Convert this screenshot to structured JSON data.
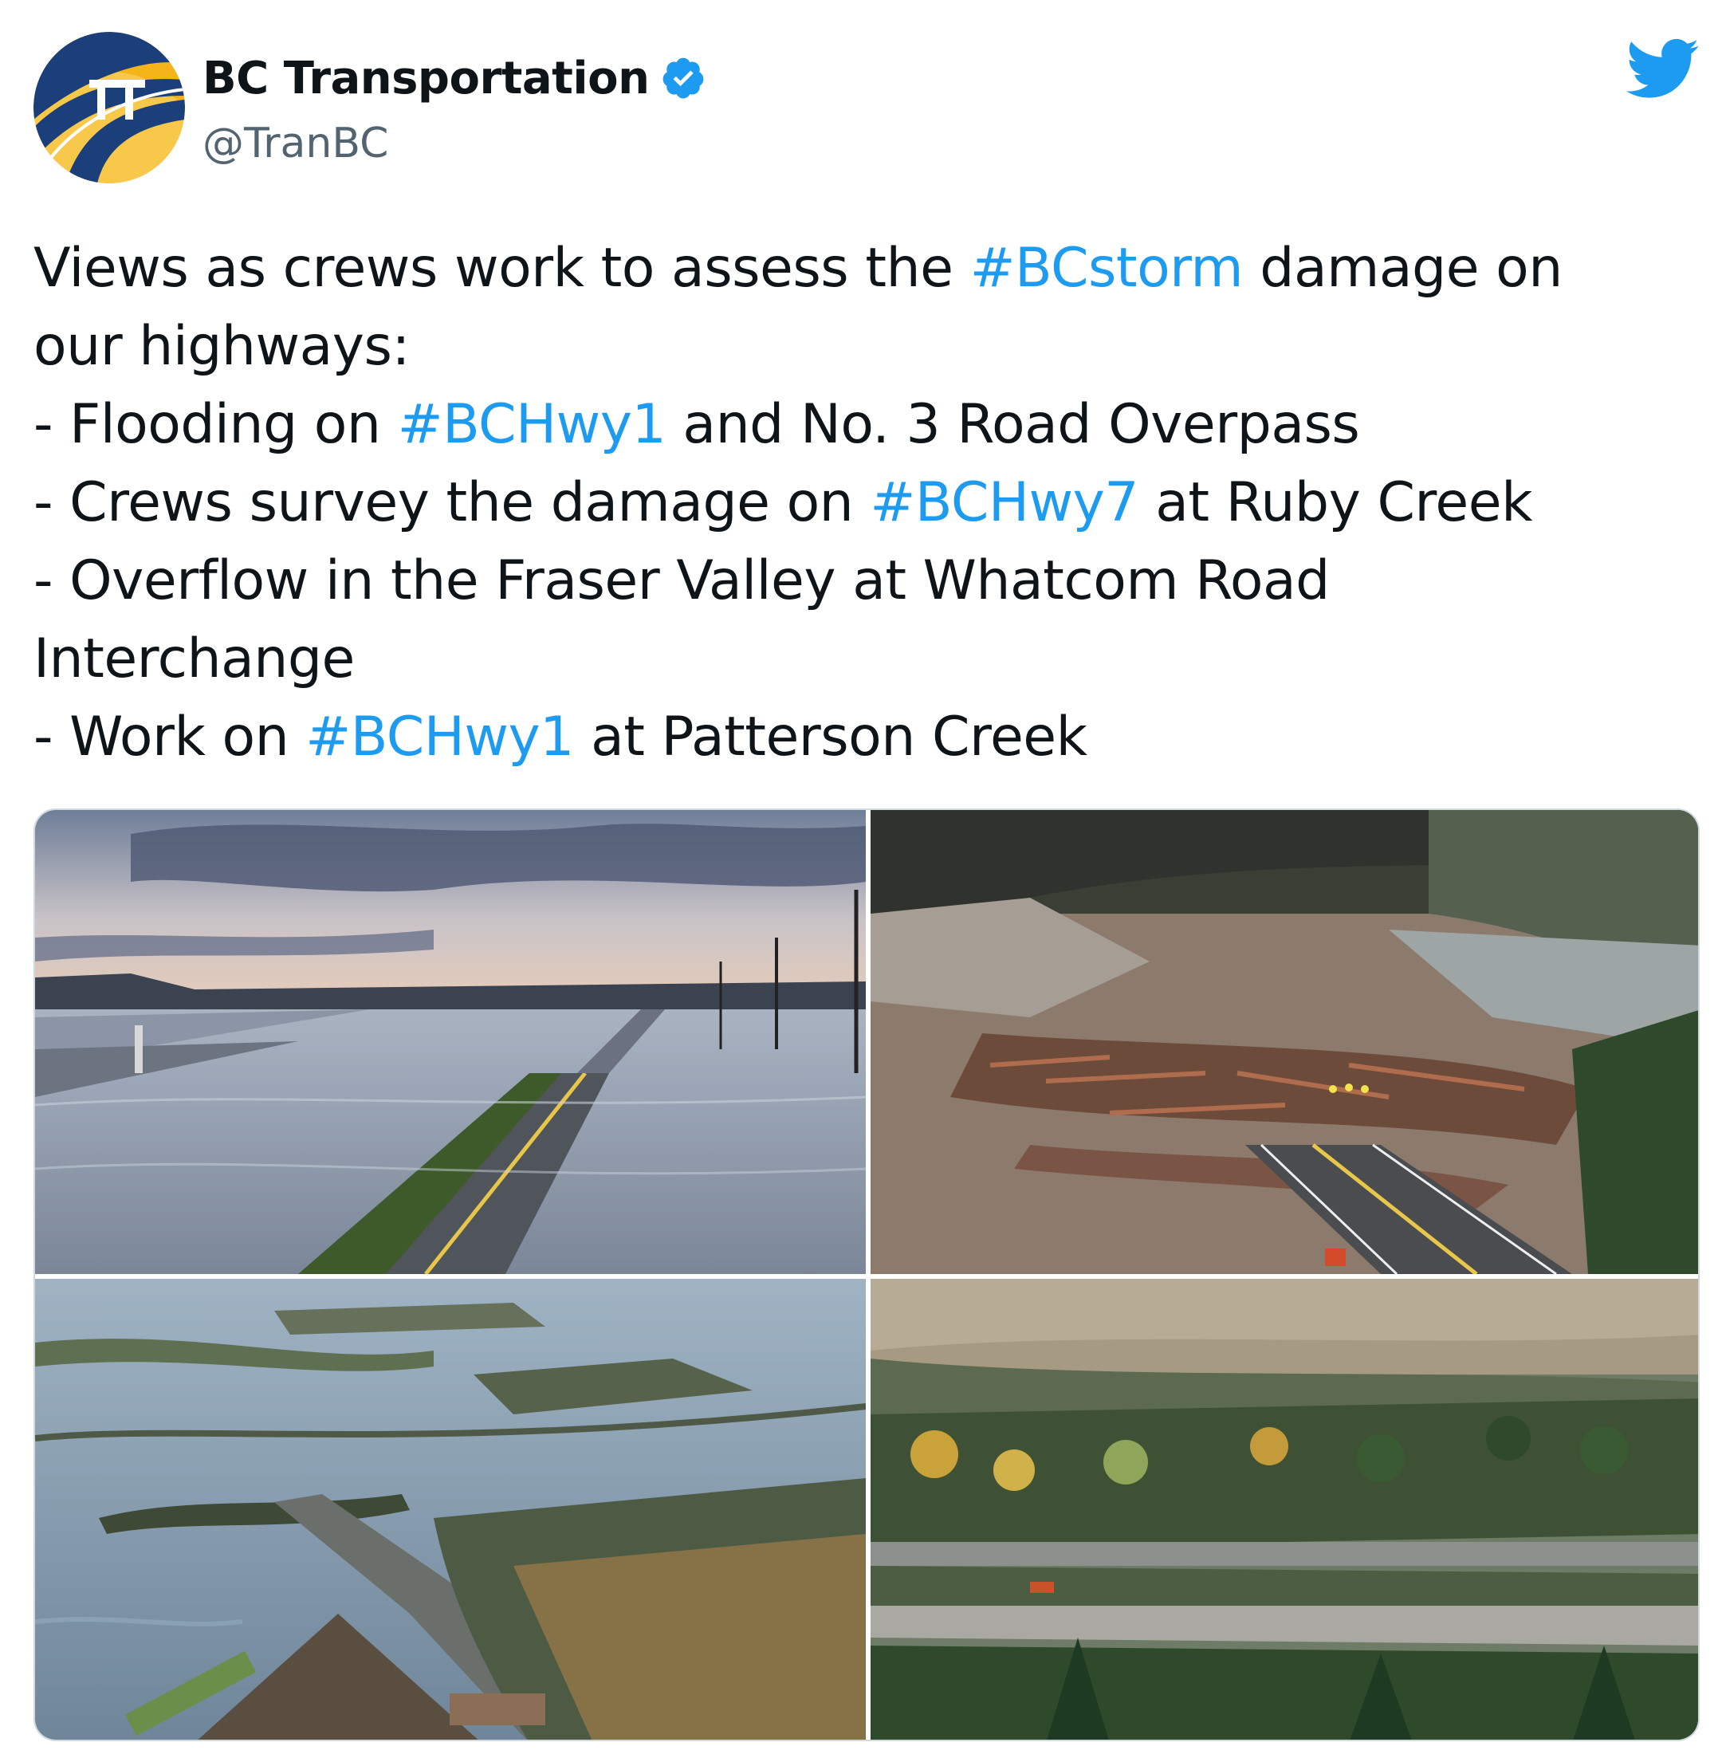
{
  "account": {
    "display_name": "BC Transportation",
    "handle": "@TranBC",
    "verified": true,
    "avatar_icon": "bc-highway-logo-icon",
    "brand_colors": {
      "avatar_blue": "#1b3f7a",
      "avatar_gold": "#f4b41a"
    }
  },
  "header": {
    "logo_icon": "twitter-bird-icon",
    "logo_color": "#1d9bf0"
  },
  "tweet": {
    "lines": [
      [
        {
          "text": "Views as crews work to assess the ",
          "hashtag": false
        },
        {
          "text": "#BCstorm",
          "hashtag": true
        },
        {
          "text": " damage on",
          "hashtag": false
        }
      ],
      [
        {
          "text": "our highways:",
          "hashtag": false
        }
      ],
      [
        {
          "text": "- Flooding on ",
          "hashtag": false
        },
        {
          "text": "#BCHwy1",
          "hashtag": true
        },
        {
          "text": " and No. 3 Road Overpass",
          "hashtag": false
        }
      ],
      [
        {
          "text": "- Crews survey the damage on ",
          "hashtag": false
        },
        {
          "text": "#BCHwy7",
          "hashtag": true
        },
        {
          "text": " at Ruby Creek",
          "hashtag": false
        }
      ],
      [
        {
          "text": "- Overflow in the Fraser Valley at Whatcom Road",
          "hashtag": false
        }
      ],
      [
        {
          "text": "Interchange",
          "hashtag": false
        }
      ],
      [
        {
          "text": "- Work on ",
          "hashtag": false
        },
        {
          "text": "#BCHwy1",
          "hashtag": true
        },
        {
          "text": " at Patterson Creek",
          "hashtag": false
        }
      ]
    ],
    "hashtag_color": "#1d9bf0"
  },
  "media": {
    "photos": [
      {
        "subject": "flooded-highway-photo"
      },
      {
        "subject": "debris-slide-highway-photo"
      },
      {
        "subject": "flooded-valley-aerial-photo"
      },
      {
        "subject": "river-forest-highway-photo"
      }
    ]
  }
}
